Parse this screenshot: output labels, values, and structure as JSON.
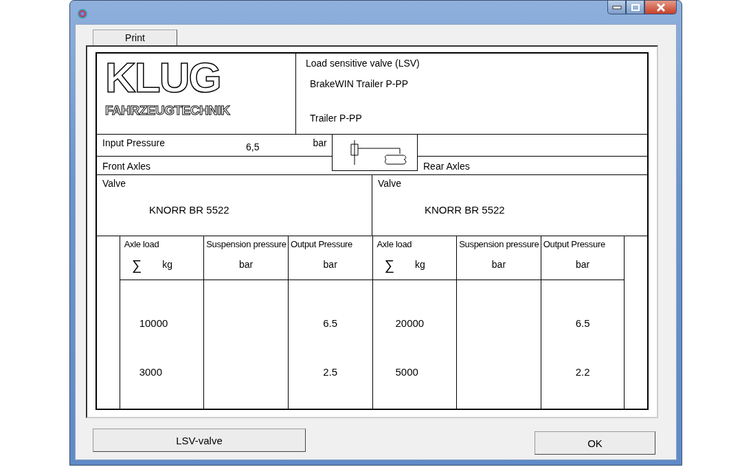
{
  "toolbar": {
    "print": "Print"
  },
  "report": {
    "logo": {
      "name": "KLUG",
      "subtitle": "FAHRZEUGTECHNIK"
    },
    "heading": "Load sensitive valve (LSV)",
    "product": "BrakeWIN Trailer P-PP",
    "trailer": "Trailer  P-PP",
    "input_pressure": {
      "label": "Input Pressure",
      "value": "6,5",
      "unit": "bar"
    },
    "front_label": "Front Axles",
    "rear_label": "Rear Axles",
    "axles": [
      {
        "valve_label": "Valve",
        "valve": "KNORR BR 5522",
        "columns": [
          {
            "title": "Axle load",
            "symbol": "∑",
            "unit": "kg"
          },
          {
            "title": "Suspension pressure",
            "unit": "bar"
          },
          {
            "title": "Output Pressure",
            "unit": "bar"
          }
        ],
        "rows": [
          {
            "axle_load": "10000",
            "output_pressure": "6.5"
          },
          {
            "axle_load": "3000",
            "output_pressure": "2.5"
          }
        ]
      },
      {
        "valve_label": "Valve",
        "valve": "KNORR BR 5522",
        "columns": [
          {
            "title": "Axle load",
            "symbol": "∑",
            "unit": "kg"
          },
          {
            "title": "Suspension pressure",
            "unit": "bar"
          },
          {
            "title": "Output Pressure",
            "unit": "bar"
          }
        ],
        "rows": [
          {
            "axle_load": "20000",
            "output_pressure": "6.5"
          },
          {
            "axle_load": "5000",
            "output_pressure": "2.2"
          }
        ]
      }
    ]
  },
  "buttons": {
    "lsv": "LSV-valve",
    "ok": "OK"
  }
}
